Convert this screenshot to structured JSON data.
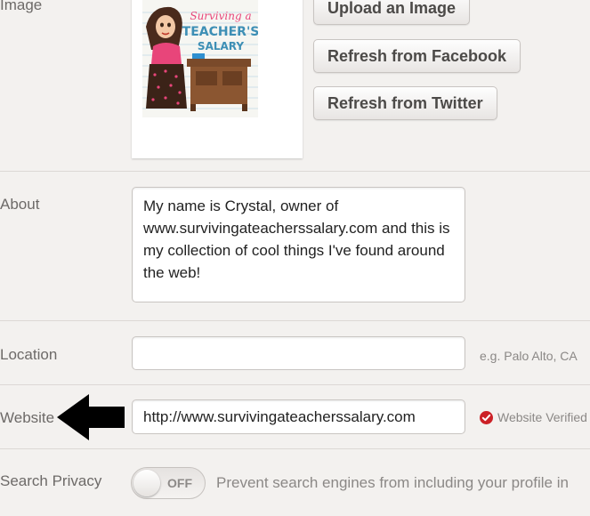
{
  "image_section": {
    "label": "Image",
    "avatar": "blog-logo-avatar",
    "avatar_text_line1": "Surviving a",
    "avatar_text_line2": "TEACHER'S",
    "avatar_text_line3": "SALARY",
    "upload_label": "Upload an Image",
    "facebook_label": "Refresh from Facebook",
    "twitter_label": "Refresh from Twitter"
  },
  "about": {
    "label": "About",
    "value": "My name is Crystal, owner of www.survivingateacherssalary.com and this is my collection of cool things I've found around the web!"
  },
  "location": {
    "label": "Location",
    "value": "",
    "hint": "e.g. Palo Alto, CA"
  },
  "website": {
    "label": "Website",
    "value": "http://www.survivingateacherssalary.com",
    "verified_label": "Website Verified",
    "verified_color": "#cc2127",
    "annotation": "left-pointing-arrow"
  },
  "search_privacy": {
    "label": "Search Privacy",
    "toggle_state": "OFF",
    "description": "Prevent search engines from including your profile in"
  }
}
